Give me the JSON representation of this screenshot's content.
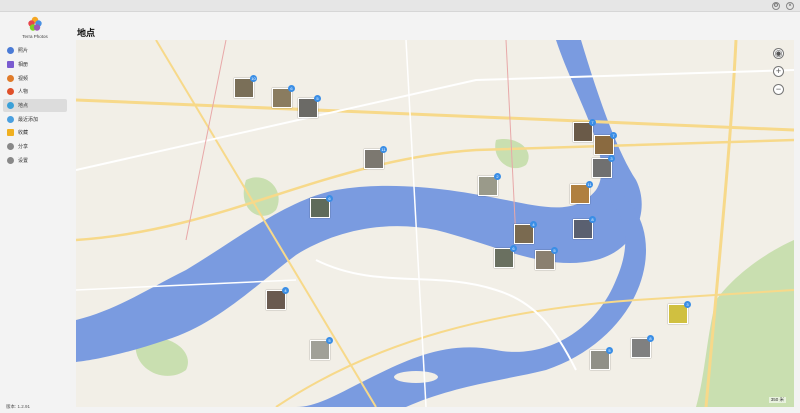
{
  "app": {
    "name": "Terra Photos",
    "version": "版本: 1.2.91"
  },
  "window": {
    "controls": [
      "settings-icon",
      "close-icon"
    ]
  },
  "sidebar": {
    "items": [
      {
        "label": "照片",
        "icon": "photos-icon",
        "color": "#4a7bd6"
      },
      {
        "label": "相册",
        "icon": "albums-icon",
        "color": "#7a5bd0"
      },
      {
        "label": "视频",
        "icon": "video-icon",
        "color": "#e07b2a"
      },
      {
        "label": "人物",
        "icon": "people-icon",
        "color": "#e0502a"
      },
      {
        "label": "地点",
        "icon": "places-icon",
        "color": "#3aa0d8",
        "active": true
      },
      {
        "label": "最近添加",
        "icon": "recent-icon",
        "color": "#4aa0e0"
      },
      {
        "label": "收藏",
        "icon": "star-icon",
        "color": "#f0b020"
      },
      {
        "label": "分享",
        "icon": "share-icon",
        "color": "#888888"
      },
      {
        "label": "设置",
        "icon": "settings-icon",
        "color": "#888888"
      }
    ]
  },
  "page": {
    "title": "地点"
  },
  "map": {
    "controls": [
      "locate-icon",
      "zoom-in-icon",
      "zoom-out-icon"
    ],
    "clusters": [
      {
        "count": "10",
        "tone": "#7a6f58"
      },
      {
        "count": "6",
        "tone": "#8a7c60"
      },
      {
        "count": "5",
        "tone": "#6b6a66"
      },
      {
        "count": "11",
        "tone": "#7c7870"
      },
      {
        "count": "6",
        "tone": "#5f6b5a"
      },
      {
        "count": "2",
        "tone": "#9a9a8a"
      },
      {
        "count": "7",
        "tone": "#6a5a48"
      },
      {
        "count": "7",
        "tone": "#8a6a40"
      },
      {
        "count": "11",
        "tone": "#b08040"
      },
      {
        "count": "3",
        "tone": "#707070"
      },
      {
        "count": "4",
        "tone": "#7a6a50"
      },
      {
        "count": "8",
        "tone": "#5a6070"
      },
      {
        "count": "6",
        "tone": "#6a7060"
      },
      {
        "count": "5",
        "tone": "#8a8070"
      },
      {
        "count": "4",
        "tone": "#6a5a50"
      },
      {
        "count": "8",
        "tone": "#808080"
      },
      {
        "count": "3",
        "tone": "#d0c040"
      },
      {
        "count": "5",
        "tone": "#909088"
      },
      {
        "count": "5",
        "tone": "#a0a098"
      }
    ],
    "scale": "350 米"
  },
  "colors": {
    "water": "#7a9be0",
    "land": "#f2efe7",
    "park": "#c9dfb0",
    "road_major": "#f7d98a"
  }
}
